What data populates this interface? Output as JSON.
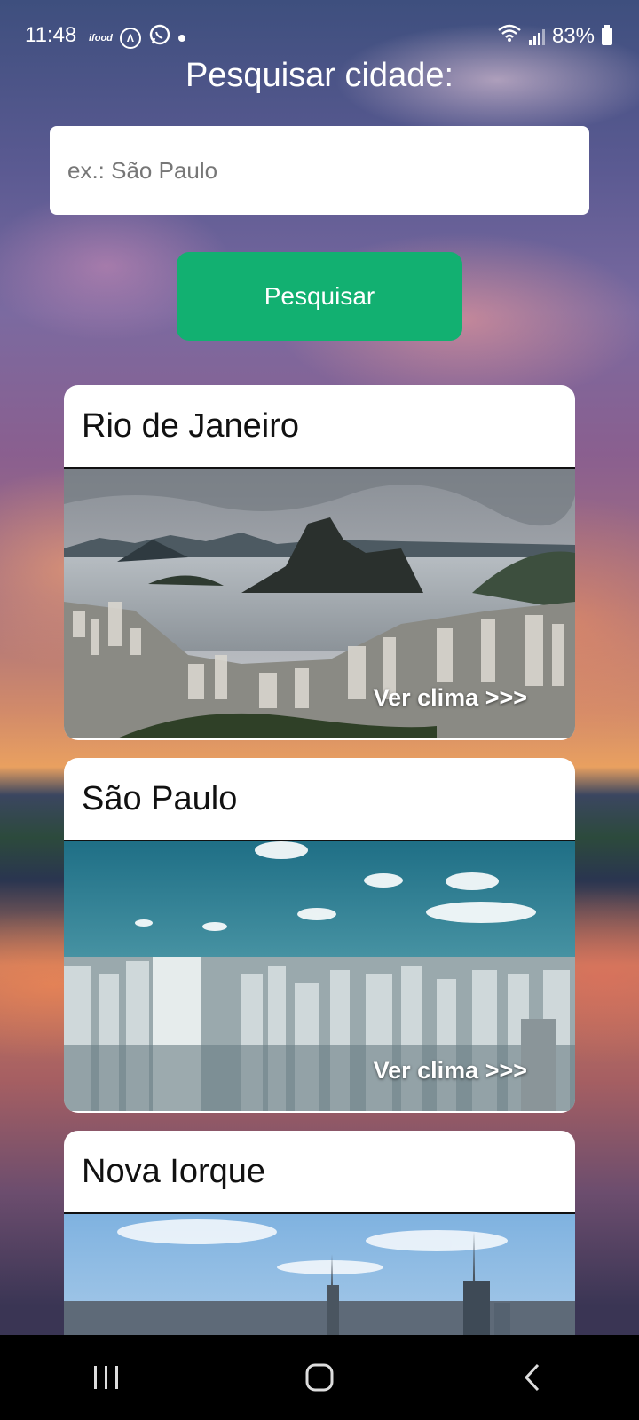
{
  "status_bar": {
    "time": "11:48",
    "battery": "83%",
    "left_icons": [
      "ifood-icon",
      "a-icon",
      "whatsapp-icon",
      "dot"
    ],
    "ifood_logo_text": "ifood",
    "a_icon_glyph": "Λ"
  },
  "search": {
    "title": "Pesquisar cidade:",
    "placeholder": "ex.: São Paulo",
    "value": "",
    "button_label": "Pesquisar",
    "button_color": "#12b071"
  },
  "cities": [
    {
      "name": "Rio de Janeiro",
      "link_label": "Ver clima >>>"
    },
    {
      "name": "São Paulo",
      "link_label": "Ver clima >>>"
    },
    {
      "name": "Nova Iorque",
      "link_label": ""
    }
  ],
  "nav_bar": {
    "buttons": [
      "recents-icon",
      "home-icon",
      "back-icon"
    ]
  }
}
